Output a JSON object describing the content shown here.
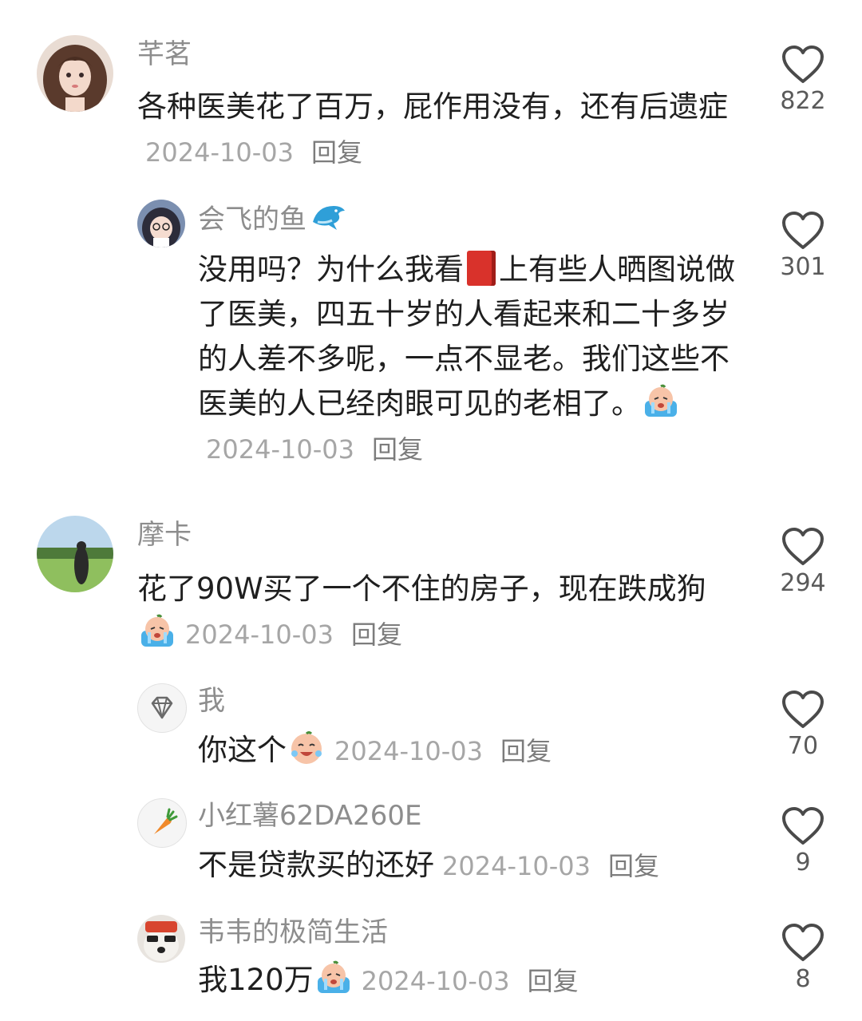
{
  "reply_label": "回复",
  "comments": [
    {
      "user": "芊茗",
      "text": "各种医美花了百万，屁作用没有，还有后遗症",
      "date": "2024-10-03",
      "likes": "822",
      "avatar_icon": "woman-portrait-avatar"
    },
    {
      "user": "会飞的鱼",
      "text_a": "没用吗？为什么我看",
      "text_b": "上有些人晒图说做了医美，四五十岁的人看起来和二十多岁的人差不多呢，一点不显老。我们这些不医美的人已经肉眼可见的老相了。",
      "date": "2024-10-03",
      "likes": "301",
      "avatar_icon": "cartoon-girl-avatar",
      "name_icon": "dolphin-icon",
      "inline_icon": "red-book-icon",
      "end_icon": "crying-face-emoji"
    },
    {
      "user": "摩卡",
      "text": "花了90W买了一个不住的房子，现在跌成狗",
      "date": "2024-10-03",
      "likes": "294",
      "avatar_icon": "field-photo-avatar",
      "end_icon": "crying-face-emoji"
    },
    {
      "user": "我",
      "text": "你这个",
      "date": "2024-10-03",
      "likes": "70",
      "avatar_icon": "diamond-icon",
      "end_icon": "laughing-crying-emoji"
    },
    {
      "user": "小红薯62DA260E",
      "text": "不是贷款买的还好",
      "date": "2024-10-03",
      "likes": "9",
      "avatar_icon": "carrot-icon"
    },
    {
      "user": "韦韦的极简生活",
      "text": "我120万",
      "date": "2024-10-03",
      "likes": "8",
      "avatar_icon": "dog-with-glasses-avatar",
      "end_icon": "crying-face-emoji"
    }
  ],
  "colors": {
    "username": "#8d8d8d",
    "body_text": "#1f1f1f",
    "date": "#a6a6a6",
    "reply": "#7c7c7c",
    "heart_outline": "#4a4a4a"
  }
}
